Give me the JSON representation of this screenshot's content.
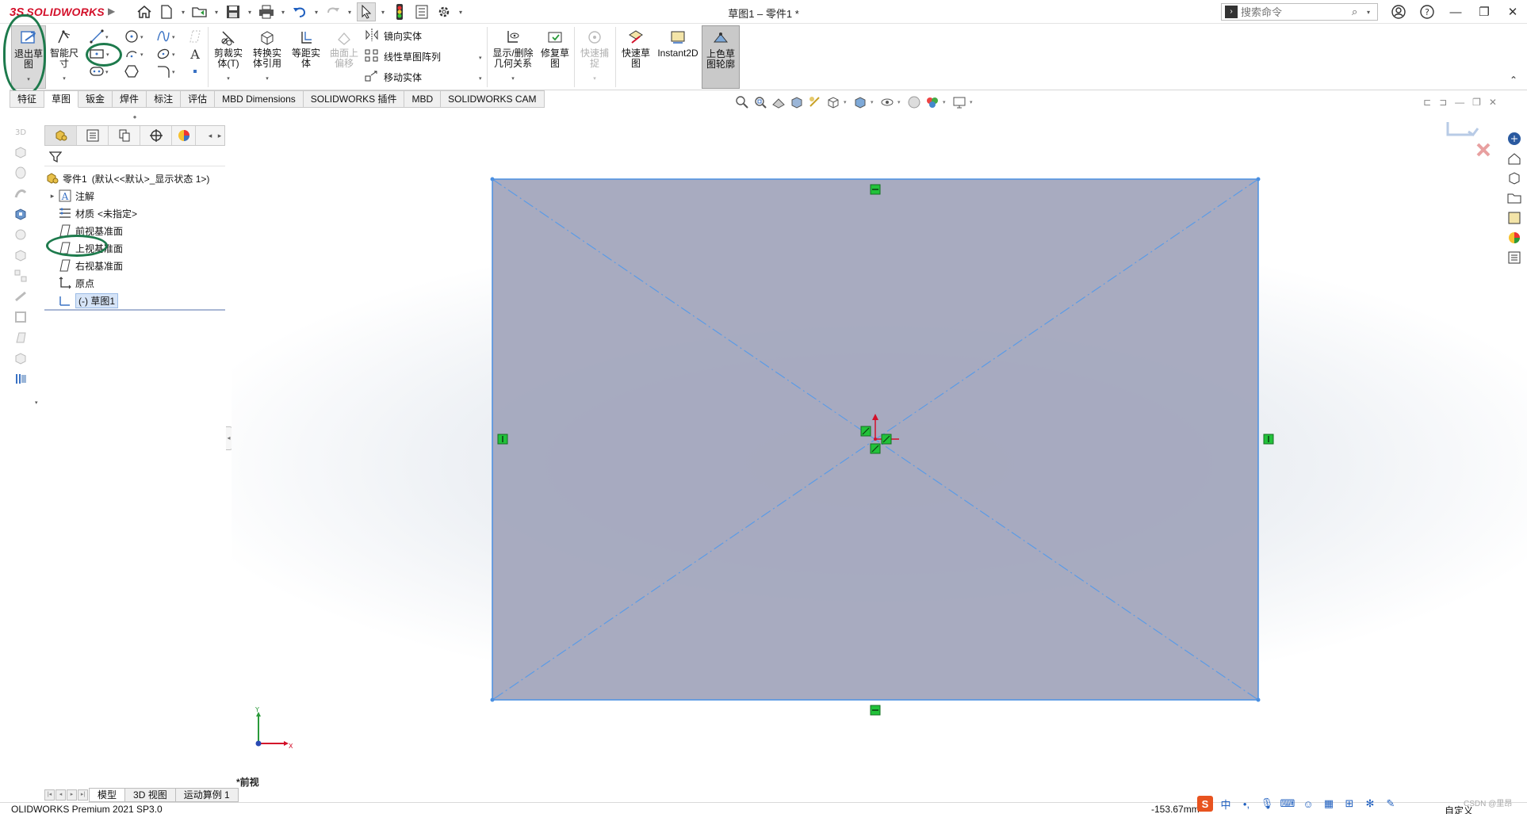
{
  "app": {
    "logo_ds": "3S",
    "logo_name": "SOLIDWORKS",
    "document_title": "草图1 – 零件1 *"
  },
  "search": {
    "placeholder": "搜索命令"
  },
  "ribbon": {
    "exit_sketch": "退出草\n图",
    "smart_dimension": "智能尺\n寸",
    "trim_entities": "剪裁实\n体(T)",
    "convert_entities": "转换实\n体引用",
    "offset_entities": "等距实\n体",
    "offset_on_surface": "曲面上\n偏移",
    "mirror_entities": "镜向实体",
    "linear_pattern": "线性草图阵列",
    "move_entities": "移动实体",
    "display_relations": "显示/删除\n几何关系",
    "repair_sketch": "修复草\n图",
    "quick_snaps": "快速捕\n捉",
    "rapid_sketch": "快速草\n图",
    "instant2d": "Instant2D",
    "shaded_sketch": "上色草\n图轮廓"
  },
  "command_tabs": [
    "特征",
    "草图",
    "钣金",
    "焊件",
    "标注",
    "评估",
    "MBD Dimensions",
    "SOLIDWORKS 插件",
    "MBD",
    "SOLIDWORKS CAM"
  ],
  "active_command_tab": "草图",
  "feature_tree": {
    "root": "零件1",
    "root_config": "(默认<<默认>_显示状态 1>)",
    "annotations": "注解",
    "material_label": "材质",
    "material_value": "<未指定>",
    "front_plane": "前视基准面",
    "top_plane": "上视基准面",
    "right_plane": "右视基准面",
    "origin": "原点",
    "sketch": "(-) 草图1"
  },
  "viewport": {
    "view_label": "*前视",
    "triad_y": "Y",
    "triad_x": "X"
  },
  "bottom_tabs": [
    "模型",
    "3D 视图",
    "运动算例 1"
  ],
  "active_bottom_tab": "模型",
  "status": {
    "product": "OLIDWORKS Premium 2021 SP3.0",
    "coordinate": "-153.67mm",
    "units": "自定义"
  },
  "ime": {
    "lang": "中"
  },
  "watermark": "CSDN @里昂",
  "colors": {
    "sketch_fill": "#a3a6bd",
    "sketch_line": "#4a90e2",
    "relation_green": "#22c23a",
    "annotation_green": "#1d7a4c",
    "brand_red": "#d3102a"
  }
}
